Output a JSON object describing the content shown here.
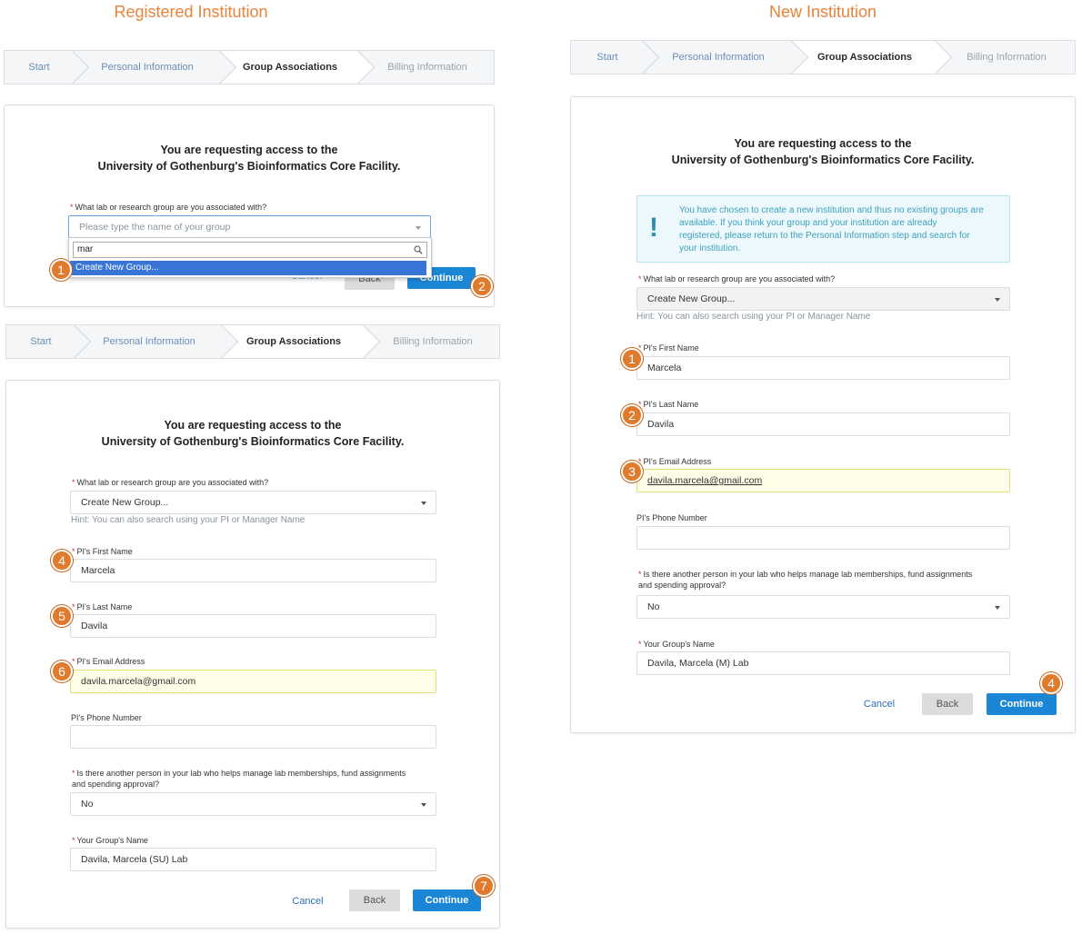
{
  "headings": {
    "registered": "Registered Institution",
    "new": "New Institution"
  },
  "stepper": {
    "start": "Start",
    "personal": "Personal Information",
    "group": "Group Associations",
    "billing": "Billing Information"
  },
  "title": {
    "line1": "You are requesting access to the",
    "line2": "University of Gothenburg's Bioinformatics Core Facility."
  },
  "fields": {
    "lab_question": "What lab or research group are you associated with?",
    "group_placeholder": "Please type the name of your group",
    "search_value": "mar",
    "create_new_group": "Create New Group...",
    "hint": "Hint: You can also search using your PI or Manager Name",
    "pi_first_label": "PI's First Name",
    "pi_first": "Marcela",
    "pi_last_label": "PI's Last Name",
    "pi_last": "Davila",
    "pi_email_label": "PI's Email Address",
    "pi_email": "davila.marcela@gmail.com",
    "pi_phone_label": "PI's Phone Number",
    "another_person_line1": "Is there another person in your lab who helps manage lab memberships, fund assignments",
    "another_person_line2": "and spending approval?",
    "another_person_value": "No",
    "group_name_label": "Your Group's Name",
    "group_name_registered": "Davila, Marcela (SU) Lab",
    "group_name_new": "Davila, Marcela (M) Lab",
    "required_mark": "*"
  },
  "buttons": {
    "cancel": "Cancel",
    "back": "Back",
    "continue": "Continue"
  },
  "alert": {
    "line1": "You have chosen to create a new institution and thus no existing groups are",
    "line2": "available. If you think your group and your institution are already",
    "line3": "registered, please return to the Personal Information step and search for",
    "line4": "your institution.",
    "icon": "!"
  },
  "badges": {
    "b1": "1",
    "b2": "2",
    "b3": "3",
    "b4": "4",
    "b5": "5",
    "b6": "6",
    "b7": "7"
  },
  "colors": {
    "accent": "#e8833a",
    "primary": "#1b85d6",
    "link": "#2f6fb5",
    "badge": "#e07b2e"
  }
}
